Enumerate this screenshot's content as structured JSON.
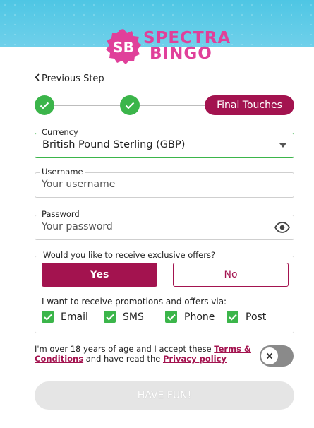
{
  "brand": {
    "line1": "SPECTRA",
    "line2": "BINGO",
    "badge": "SB",
    "color": "#e0409a"
  },
  "nav": {
    "previous_step": "Previous Step"
  },
  "stepper": {
    "final_label": "Final Touches",
    "completed_steps": 2
  },
  "currency": {
    "label": "Currency",
    "value": "British Pound Sterling (GBP)"
  },
  "username": {
    "label": "Username",
    "placeholder": "Your username"
  },
  "password": {
    "label": "Password",
    "placeholder": "Your password"
  },
  "offers": {
    "question": "Would you like to receive exclusive offers?",
    "yes": "Yes",
    "no": "No",
    "via_text": "I want to receive promotions and offers via:",
    "channels": [
      "Email",
      "SMS",
      "Phone",
      "Post"
    ]
  },
  "terms": {
    "prefix": "I'm over 18 years of age and I accept these ",
    "terms_link": "Terms & Conditions",
    "middle": " and have read the ",
    "privacy_link": "Privacy policy"
  },
  "submit": {
    "label": "HAVE FUN!"
  },
  "colors": {
    "accent": "#a3134f",
    "success": "#3bb54a",
    "sky": "#4ec6e4"
  }
}
